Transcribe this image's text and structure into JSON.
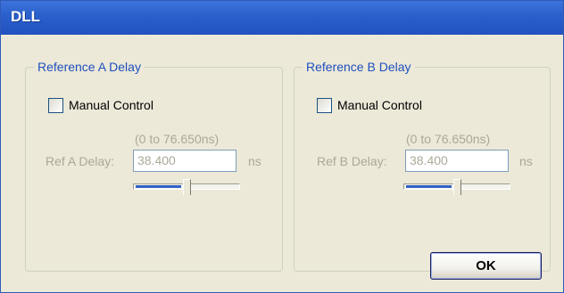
{
  "window": {
    "title": "DLL"
  },
  "groups": [
    {
      "title": "Reference A Delay",
      "checkbox_label": "Manual Control",
      "checked": false,
      "range": "(0 to 76.650ns)",
      "delay_label": "Ref A Delay:",
      "delay_value": "38.400",
      "unit": "ns",
      "slider_fraction": 0.5,
      "enabled": false
    },
    {
      "title": "Reference B Delay",
      "checkbox_label": "Manual Control",
      "checked": false,
      "range": "(0 to 76.650ns)",
      "delay_label": "Ref B Delay:",
      "delay_value": "38.400",
      "unit": "ns",
      "slider_fraction": 0.5,
      "enabled": false
    }
  ],
  "buttons": {
    "ok_label": "OK"
  },
  "colors": {
    "titlebar": "#2a5fcc",
    "group_title": "#1f4fbf",
    "disabled_text": "#aca899",
    "dialog_bg": "#ece9d8"
  }
}
